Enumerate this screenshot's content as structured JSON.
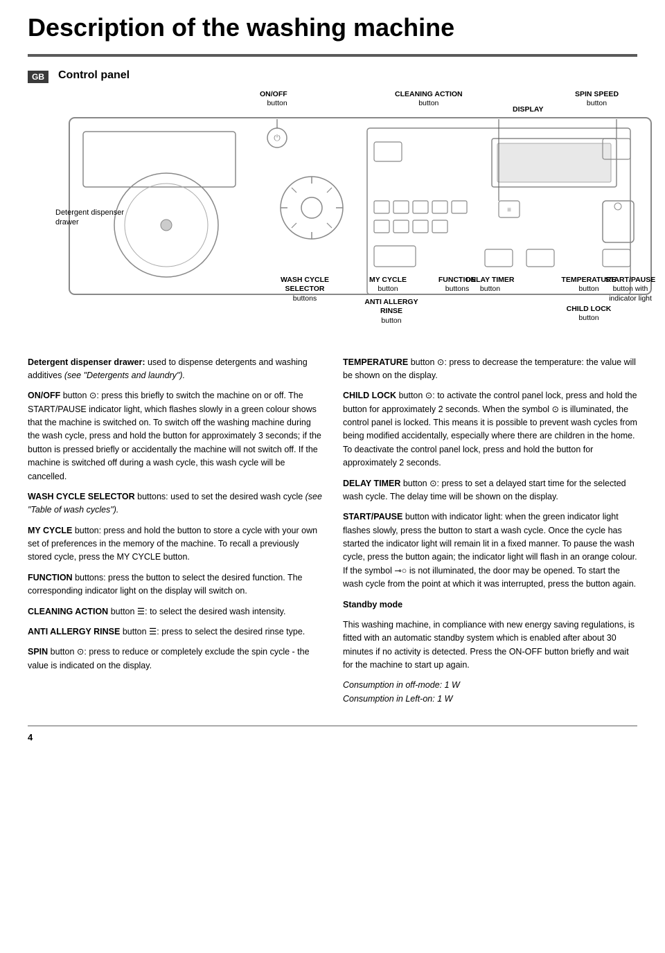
{
  "page": {
    "title": "Description of the washing machine",
    "page_number": "4",
    "section": {
      "badge": "GB",
      "heading": "Control panel"
    }
  },
  "diagram": {
    "labels": {
      "on_off": {
        "title": "ON/OFF",
        "sub": "button"
      },
      "cleaning_action": {
        "title": "CLEANING ACTION",
        "sub": "button"
      },
      "spin_speed": {
        "title": "SPIN SPEED",
        "sub": "button"
      },
      "display": {
        "title": "DISPLAY"
      },
      "detergent": {
        "title": "Detergent dispenser drawer"
      },
      "wash_cycle": {
        "title": "WASH CYCLE SELECTOR",
        "sub": "buttons"
      },
      "my_cycle": {
        "title": "MY CYCLE",
        "sub": "button"
      },
      "function": {
        "title": "FUNCTION",
        "sub": "buttons"
      },
      "start_pause": {
        "title": "START/PAUSE",
        "sub": "button with indicator light"
      },
      "anti_allergy": {
        "title": "ANTI ALLERGY RINSE",
        "sub": "button"
      },
      "delay_timer": {
        "title": "DELAY TIMER",
        "sub": "button"
      },
      "temperature": {
        "title": "TEMPERATURE",
        "sub": "button"
      },
      "child_lock": {
        "title": "CHILD LOCK",
        "sub": "button"
      }
    }
  },
  "text_left": [
    {
      "term": "Detergent dispenser drawer:",
      "text": " used to dispense detergents and washing additives ",
      "italic": "(see \"Detergents and laundry\").",
      "rest": ""
    },
    {
      "term": "ON/OFF",
      "text": " button ⊙: press this briefly to switch the machine on or off. The START/PAUSE indicator light, which flashes slowly in a green colour shows that the machine is switched on. To switch off the washing machine during the wash cycle, press and hold the button for approximately 3 seconds; if the button is pressed briefly or accidentally the machine will not switch off. If the machine is switched off during a wash cycle, this wash cycle will be cancelled.",
      "italic": "",
      "rest": ""
    },
    {
      "term": "WASH CYCLE SELECTOR",
      "text": " buttons: used to set the desired wash cycle ",
      "italic": "(see \"Table of wash cycles\").",
      "rest": ""
    },
    {
      "term": "MY CYCLE",
      "text": " button: press and hold the button to store a cycle with your own set of preferences in the memory of the machine. To recall a previously stored cycle, press the MY CYCLE button.",
      "italic": "",
      "rest": ""
    },
    {
      "term": "FUNCTION",
      "text": " buttons: press the button to select the desired function. The corresponding indicator light on the display will switch on.",
      "italic": "",
      "rest": ""
    },
    {
      "term": "CLEANING ACTION",
      "text": " button 🖱: to select the desired wash intensity.",
      "italic": "",
      "rest": ""
    },
    {
      "term": "ANTI ALLERGY RINSE",
      "text": " button 🖱: press to select the desired rinse type.",
      "italic": "",
      "rest": ""
    },
    {
      "term": "SPIN",
      "text": " button ⊙: press to reduce or completely exclude the spin cycle - the value is indicated on the display.",
      "italic": "",
      "rest": ""
    }
  ],
  "text_right": [
    {
      "term": "TEMPERATURE",
      "text": " button ⊙: press to decrease the temperature: the value will be shown on the display.",
      "italic": "",
      "rest": ""
    },
    {
      "term": "CHILD LOCK",
      "text": " button ⊙: to activate the control panel lock, press and hold the button for approximately 2 seconds. When the symbol ⊙ is illuminated, the control panel is locked. This means it is possible to prevent wash cycles from being modified accidentally, especially where there are children in the home. To deactivate the control panel lock, press and hold the button for approximately 2 seconds.",
      "italic": "",
      "rest": ""
    },
    {
      "term": "DELAY TIMER",
      "text": " button ⊙: press to set a delayed start time for the selected wash cycle. The delay time will be shown on the display.",
      "italic": "",
      "rest": ""
    },
    {
      "term": "START/PAUSE",
      "text": " button with indicator light: when the green indicator light flashes slowly, press the button to start a wash cycle. Once the cycle has started the indicator light will remain lit in a fixed manner. To pause the wash cycle, press the button again; the indicator light will flash in an orange colour. If the symbol ⊸○ is not illuminated, the door may be opened. To start the wash cycle from the point at which it was interrupted, press the button again.",
      "italic": "",
      "rest": ""
    }
  ],
  "standby": {
    "title": "Standby mode",
    "text": "This washing machine, in compliance with new energy saving regulations, is fitted with an automatic standby system which is enabled after about 30 minutes if no activity is detected. Press the ON-OFF button briefly and wait for the machine to start up again.",
    "consumption1": "Consumption in off-mode: 1 W",
    "consumption2": "Consumption in Left-on: 1 W"
  }
}
